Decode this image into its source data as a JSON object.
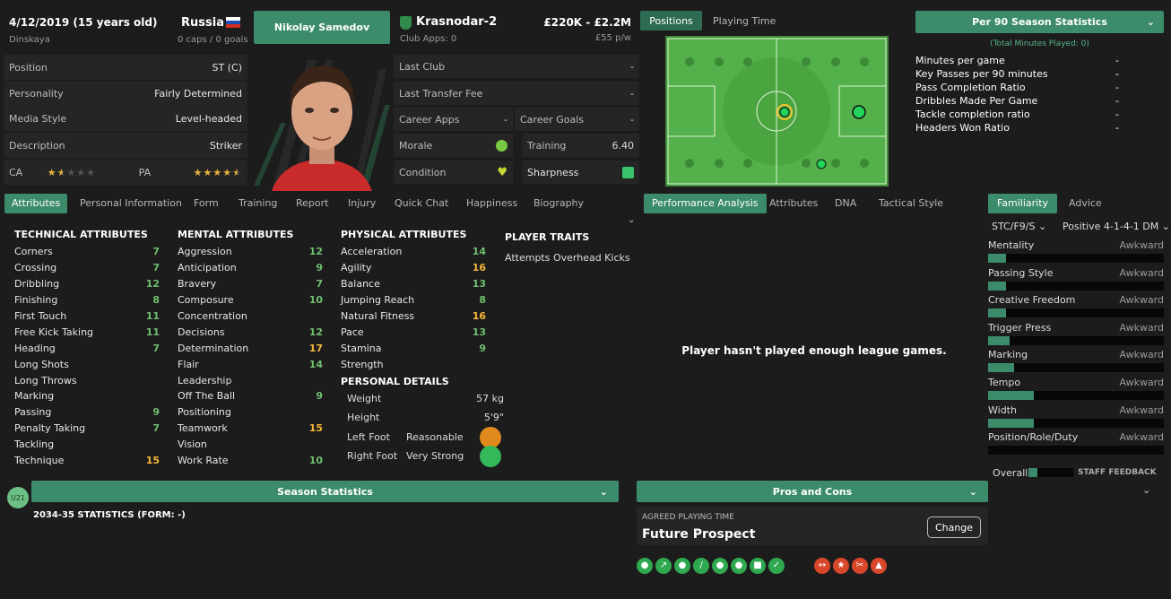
{
  "header": {
    "dob": "4/12/2019 (15 years old)",
    "place": "Dinskaya",
    "nation": "Russia",
    "caps": "0 caps / 0 goals",
    "name_button": "Nikolay Samedov",
    "club": "Krasnodar-2",
    "club_apps": "Club Apps: 0",
    "value": "£220K - £2.2M",
    "wage": "£55 p/w"
  },
  "info_rows": [
    {
      "k": "Position",
      "v": "ST (C)"
    },
    {
      "k": "Personality",
      "v": "Fairly Determined"
    },
    {
      "k": "Media Style",
      "v": "Level-headed"
    },
    {
      "k": "Description",
      "v": "Striker"
    }
  ],
  "ca_label": "CA",
  "pa_label": "PA",
  "ca_stars": 1.5,
  "pa_stars": 4.5,
  "club_rows": {
    "last_club": "Last Club",
    "last_club_v": "-",
    "last_fee": "Last Transfer Fee",
    "last_fee_v": "-",
    "career_apps": "Career Apps",
    "career_apps_v": "-",
    "career_goals": "Career Goals",
    "career_goals_v": "-",
    "morale": "Morale",
    "training": "Training",
    "training_v": "6.40",
    "condition": "Condition",
    "sharpness": "Sharpness"
  },
  "tabs": [
    "Attributes",
    "Personal Information",
    "Form",
    "Training",
    "Report",
    "Injury",
    "Quick Chat",
    "Happiness",
    "Biography"
  ],
  "technical": {
    "title": "TECHNICAL ATTRIBUTES",
    "rows": [
      [
        "Corners",
        "7",
        "g"
      ],
      [
        "Crossing",
        "7",
        "g"
      ],
      [
        "Dribbling",
        "12",
        "g"
      ],
      [
        "Finishing",
        "8",
        "g"
      ],
      [
        "First Touch",
        "11",
        "g"
      ],
      [
        "Free Kick Taking",
        "11",
        "g"
      ],
      [
        "Heading",
        "7",
        "g"
      ],
      [
        "Long Shots",
        "",
        ""
      ],
      [
        "Long Throws",
        "",
        ""
      ],
      [
        "Marking",
        "",
        ""
      ],
      [
        "Passing",
        "9",
        "g"
      ],
      [
        "Penalty Taking",
        "7",
        "g"
      ],
      [
        "Tackling",
        "",
        ""
      ],
      [
        "Technique",
        "15",
        "y"
      ]
    ]
  },
  "mental": {
    "title": "MENTAL ATTRIBUTES",
    "rows": [
      [
        "Aggression",
        "12",
        "g"
      ],
      [
        "Anticipation",
        "9",
        "g"
      ],
      [
        "Bravery",
        "7",
        "g"
      ],
      [
        "Composure",
        "10",
        "g"
      ],
      [
        "Concentration",
        "",
        ""
      ],
      [
        "Decisions",
        "12",
        "g"
      ],
      [
        "Determination",
        "17",
        "y"
      ],
      [
        "Flair",
        "14",
        "g"
      ],
      [
        "Leadership",
        "",
        ""
      ],
      [
        "Off The Ball",
        "9",
        "g"
      ],
      [
        "Positioning",
        "",
        ""
      ],
      [
        "Teamwork",
        "15",
        "y"
      ],
      [
        "Vision",
        "",
        ""
      ],
      [
        "Work Rate",
        "10",
        "g"
      ]
    ]
  },
  "physical": {
    "title": "PHYSICAL ATTRIBUTES",
    "rows": [
      [
        "Acceleration",
        "14",
        "g"
      ],
      [
        "Agility",
        "16",
        "y"
      ],
      [
        "Balance",
        "13",
        "g"
      ],
      [
        "Jumping Reach",
        "8",
        "g"
      ],
      [
        "Natural Fitness",
        "16",
        "y"
      ],
      [
        "Pace",
        "13",
        "g"
      ],
      [
        "Stamina",
        "9",
        "g"
      ],
      [
        "Strength",
        "",
        ""
      ]
    ]
  },
  "personal": {
    "title": "PERSONAL DETAILS",
    "weight": "Weight",
    "weight_v": "57 kg",
    "height": "Height",
    "height_v": "5'9\"",
    "left_foot": "Left Foot",
    "left_foot_v": "Reasonable",
    "right_foot": "Right Foot",
    "right_foot_v": "Very Strong"
  },
  "traits": {
    "title": "PLAYER TRAITS",
    "items": [
      "Attempts Overhead Kicks"
    ]
  },
  "positions": {
    "tab1": "Positions",
    "tab2": "Playing Time"
  },
  "per90": {
    "title": "Per 90 Season Statistics",
    "sub": "(Total Minutes Played: 0)",
    "rows": [
      [
        "Minutes per game",
        "-"
      ],
      [
        "Key Passes per 90 minutes",
        "-"
      ],
      [
        "Pass Completion Ratio",
        "-"
      ],
      [
        "Dribbles Made Per Game",
        "-"
      ],
      [
        "Tackle completion ratio",
        "-"
      ],
      [
        "Headers Won Ratio",
        "-"
      ]
    ]
  },
  "perf_tabs": [
    "Performance Analysis",
    "Attributes",
    "DNA",
    "Tactical Style"
  ],
  "perf_msg": "Player hasn't played enough league games.",
  "fam": {
    "tab1": "Familiarity",
    "tab2": "Advice",
    "role": "STC/F9/S",
    "tactic": "Positive 4-1-4-1 DM",
    "rows": [
      [
        "Mentality",
        "Awkward",
        0.1
      ],
      [
        "Passing Style",
        "Awkward",
        0.1
      ],
      [
        "Creative Freedom",
        "Awkward",
        0.1
      ],
      [
        "Trigger Press",
        "Awkward",
        0.12
      ],
      [
        "Marking",
        "Awkward",
        0.15
      ],
      [
        "Tempo",
        "Awkward",
        0.26
      ],
      [
        "Width",
        "Awkward",
        0.26
      ],
      [
        "Position/Role/Duty",
        "Awkward",
        0
      ]
    ],
    "overall": "Overall",
    "staff": "STAFF FEEDBACK"
  },
  "season": {
    "badge": "U21",
    "title": "Season Statistics",
    "line": "2034-35 STATISTICS (FORM: -)"
  },
  "pros": {
    "title": "Pros and Cons",
    "agreed": "AGREED PLAYING TIME",
    "status": "Future Prospect",
    "change": "Change"
  }
}
